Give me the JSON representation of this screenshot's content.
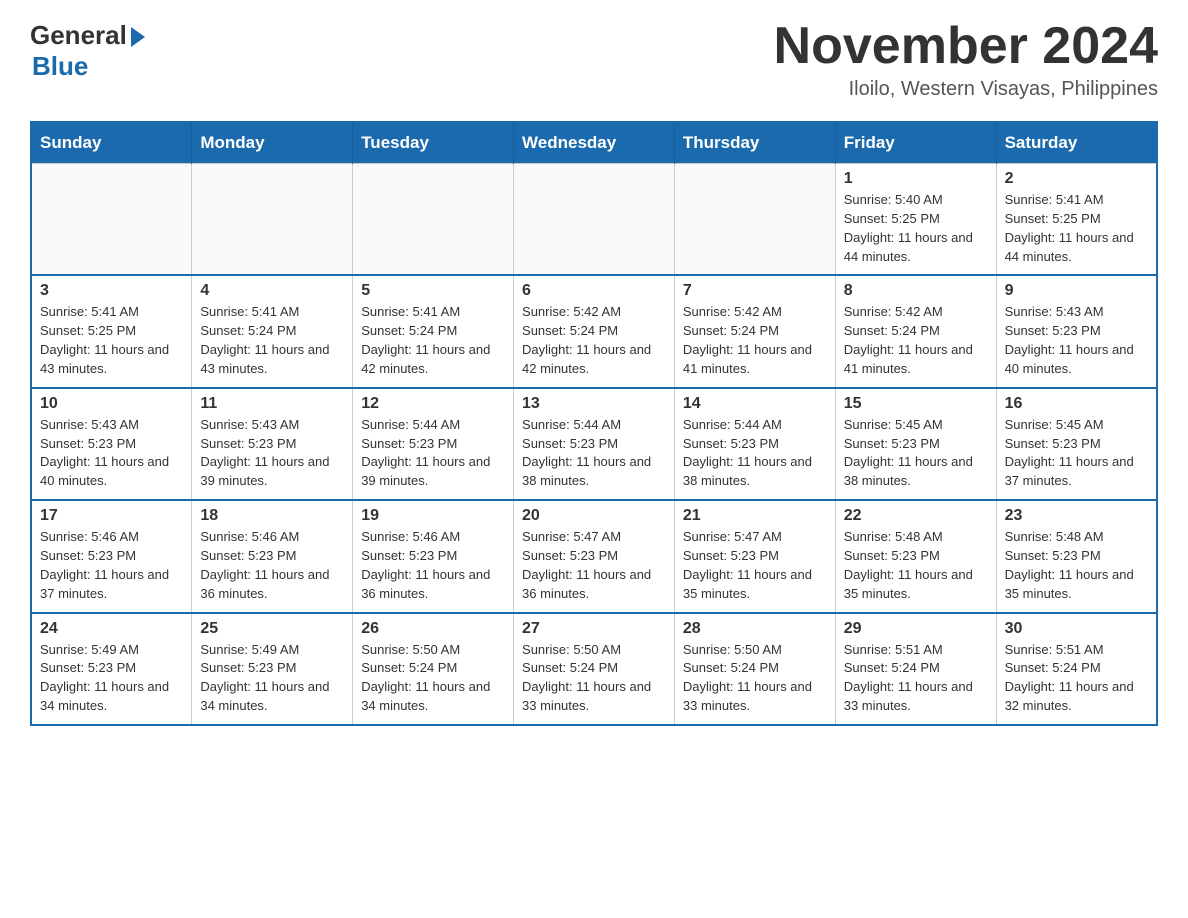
{
  "header": {
    "logo_general": "General",
    "logo_blue": "Blue",
    "month_title": "November 2024",
    "subtitle": "Iloilo, Western Visayas, Philippines"
  },
  "days_of_week": [
    "Sunday",
    "Monday",
    "Tuesday",
    "Wednesday",
    "Thursday",
    "Friday",
    "Saturday"
  ],
  "weeks": [
    [
      {
        "day": "",
        "info": ""
      },
      {
        "day": "",
        "info": ""
      },
      {
        "day": "",
        "info": ""
      },
      {
        "day": "",
        "info": ""
      },
      {
        "day": "",
        "info": ""
      },
      {
        "day": "1",
        "info": "Sunrise: 5:40 AM\nSunset: 5:25 PM\nDaylight: 11 hours and 44 minutes."
      },
      {
        "day": "2",
        "info": "Sunrise: 5:41 AM\nSunset: 5:25 PM\nDaylight: 11 hours and 44 minutes."
      }
    ],
    [
      {
        "day": "3",
        "info": "Sunrise: 5:41 AM\nSunset: 5:25 PM\nDaylight: 11 hours and 43 minutes."
      },
      {
        "day": "4",
        "info": "Sunrise: 5:41 AM\nSunset: 5:24 PM\nDaylight: 11 hours and 43 minutes."
      },
      {
        "day": "5",
        "info": "Sunrise: 5:41 AM\nSunset: 5:24 PM\nDaylight: 11 hours and 42 minutes."
      },
      {
        "day": "6",
        "info": "Sunrise: 5:42 AM\nSunset: 5:24 PM\nDaylight: 11 hours and 42 minutes."
      },
      {
        "day": "7",
        "info": "Sunrise: 5:42 AM\nSunset: 5:24 PM\nDaylight: 11 hours and 41 minutes."
      },
      {
        "day": "8",
        "info": "Sunrise: 5:42 AM\nSunset: 5:24 PM\nDaylight: 11 hours and 41 minutes."
      },
      {
        "day": "9",
        "info": "Sunrise: 5:43 AM\nSunset: 5:23 PM\nDaylight: 11 hours and 40 minutes."
      }
    ],
    [
      {
        "day": "10",
        "info": "Sunrise: 5:43 AM\nSunset: 5:23 PM\nDaylight: 11 hours and 40 minutes."
      },
      {
        "day": "11",
        "info": "Sunrise: 5:43 AM\nSunset: 5:23 PM\nDaylight: 11 hours and 39 minutes."
      },
      {
        "day": "12",
        "info": "Sunrise: 5:44 AM\nSunset: 5:23 PM\nDaylight: 11 hours and 39 minutes."
      },
      {
        "day": "13",
        "info": "Sunrise: 5:44 AM\nSunset: 5:23 PM\nDaylight: 11 hours and 38 minutes."
      },
      {
        "day": "14",
        "info": "Sunrise: 5:44 AM\nSunset: 5:23 PM\nDaylight: 11 hours and 38 minutes."
      },
      {
        "day": "15",
        "info": "Sunrise: 5:45 AM\nSunset: 5:23 PM\nDaylight: 11 hours and 38 minutes."
      },
      {
        "day": "16",
        "info": "Sunrise: 5:45 AM\nSunset: 5:23 PM\nDaylight: 11 hours and 37 minutes."
      }
    ],
    [
      {
        "day": "17",
        "info": "Sunrise: 5:46 AM\nSunset: 5:23 PM\nDaylight: 11 hours and 37 minutes."
      },
      {
        "day": "18",
        "info": "Sunrise: 5:46 AM\nSunset: 5:23 PM\nDaylight: 11 hours and 36 minutes."
      },
      {
        "day": "19",
        "info": "Sunrise: 5:46 AM\nSunset: 5:23 PM\nDaylight: 11 hours and 36 minutes."
      },
      {
        "day": "20",
        "info": "Sunrise: 5:47 AM\nSunset: 5:23 PM\nDaylight: 11 hours and 36 minutes."
      },
      {
        "day": "21",
        "info": "Sunrise: 5:47 AM\nSunset: 5:23 PM\nDaylight: 11 hours and 35 minutes."
      },
      {
        "day": "22",
        "info": "Sunrise: 5:48 AM\nSunset: 5:23 PM\nDaylight: 11 hours and 35 minutes."
      },
      {
        "day": "23",
        "info": "Sunrise: 5:48 AM\nSunset: 5:23 PM\nDaylight: 11 hours and 35 minutes."
      }
    ],
    [
      {
        "day": "24",
        "info": "Sunrise: 5:49 AM\nSunset: 5:23 PM\nDaylight: 11 hours and 34 minutes."
      },
      {
        "day": "25",
        "info": "Sunrise: 5:49 AM\nSunset: 5:23 PM\nDaylight: 11 hours and 34 minutes."
      },
      {
        "day": "26",
        "info": "Sunrise: 5:50 AM\nSunset: 5:24 PM\nDaylight: 11 hours and 34 minutes."
      },
      {
        "day": "27",
        "info": "Sunrise: 5:50 AM\nSunset: 5:24 PM\nDaylight: 11 hours and 33 minutes."
      },
      {
        "day": "28",
        "info": "Sunrise: 5:50 AM\nSunset: 5:24 PM\nDaylight: 11 hours and 33 minutes."
      },
      {
        "day": "29",
        "info": "Sunrise: 5:51 AM\nSunset: 5:24 PM\nDaylight: 11 hours and 33 minutes."
      },
      {
        "day": "30",
        "info": "Sunrise: 5:51 AM\nSunset: 5:24 PM\nDaylight: 11 hours and 32 minutes."
      }
    ]
  ]
}
